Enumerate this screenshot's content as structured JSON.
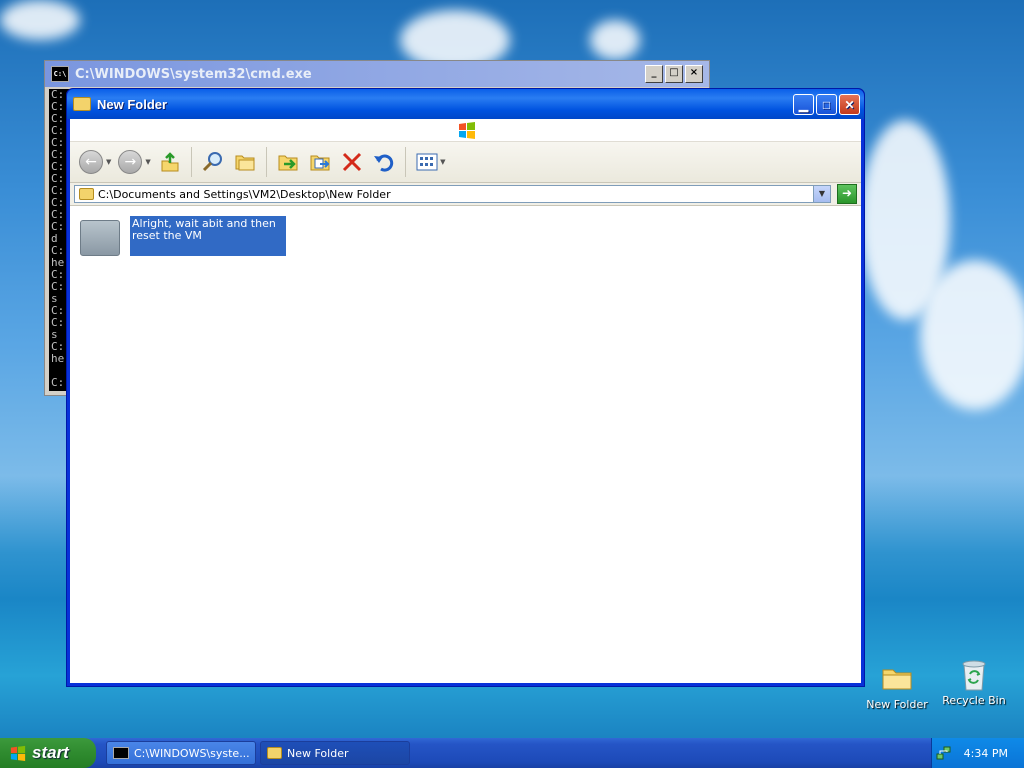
{
  "desktop": {
    "icons": [
      {
        "label": "New Folder",
        "icon": "folder-icon"
      },
      {
        "label": "Recycle Bin",
        "icon": "recycle-bin-icon"
      }
    ]
  },
  "cmd_window": {
    "title": "C:\\WINDOWS\\system32\\cmd.exe",
    "minimize": "_",
    "maximize": "□",
    "close": "×",
    "lines": [
      "C:",
      "C:",
      "C:",
      "C:",
      "C:",
      "C:",
      "C:",
      "C:",
      "C:",
      "C:",
      "C:",
      "C:",
      "d",
      "C:",
      "he",
      "C:",
      "C:",
      "s",
      "C:",
      "C:",
      "s",
      "C:",
      "he",
      "",
      "C:"
    ]
  },
  "explorer": {
    "title": "New Folder",
    "address": "C:\\Documents and Settings\\VM2\\Desktop\\New Folder",
    "items": [
      {
        "name": "Alright, wait abit and then reset the VM",
        "icon": "folder-icon",
        "selected": true
      }
    ]
  },
  "taskbar": {
    "start_label": "start",
    "tasks": [
      {
        "label": "C:\\WINDOWS\\syste...",
        "icon": "cmd-icon",
        "active": false
      },
      {
        "label": "New Folder",
        "icon": "folder-icon",
        "active": true
      }
    ],
    "clock": "4:34 PM"
  }
}
